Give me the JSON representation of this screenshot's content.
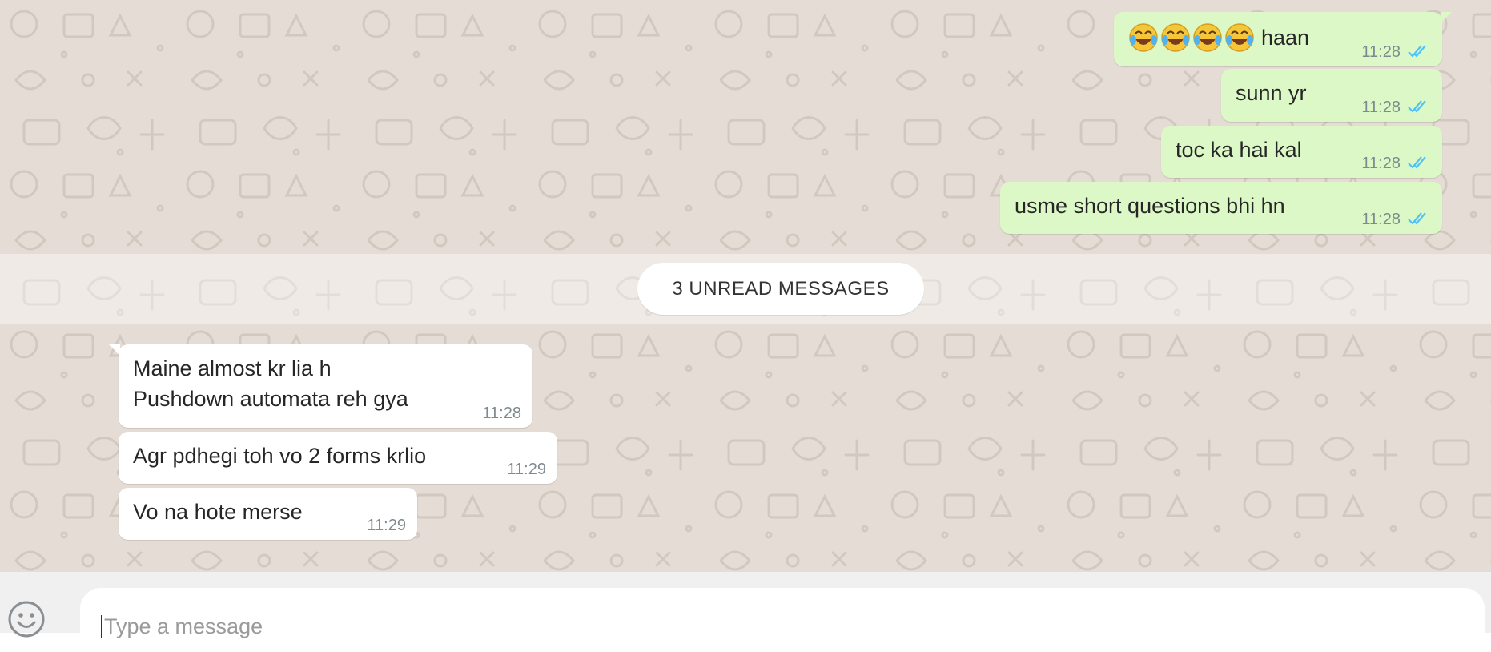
{
  "conversation": {
    "outgoing": [
      {
        "text": "haan",
        "emoji_prefix": [
          "face-with-tears-of-joy",
          "face-with-tears-of-joy",
          "face-with-tears-of-joy",
          "face-with-tears-of-joy"
        ],
        "time": "11:28",
        "status": "read"
      },
      {
        "text": "sunn yr",
        "time": "11:28",
        "status": "read"
      },
      {
        "text": "toc ka hai kal",
        "time": "11:28",
        "status": "read"
      },
      {
        "text": "usme short questions bhi hn",
        "time": "11:28",
        "status": "read"
      }
    ],
    "unread_divider": "3 UNREAD MESSAGES",
    "incoming": [
      {
        "lines": [
          "Maine almost kr lia h",
          "Pushdown automata reh gya"
        ],
        "time": "11:28"
      },
      {
        "text": "Agr pdhegi toh vo 2 forms krlio",
        "time": "11:29"
      },
      {
        "text": "Vo na hote merse",
        "time": "11:29"
      }
    ]
  },
  "composer": {
    "placeholder": "Type a message",
    "value": "",
    "emoji_button_icon": "smiley-icon"
  },
  "colors": {
    "chat_background": "#e5ddd5",
    "outgoing_bubble": "#dcf8c6",
    "incoming_bubble": "#ffffff",
    "read_ticks": "#4fc3f7",
    "footer_background": "#f0f0f0"
  }
}
